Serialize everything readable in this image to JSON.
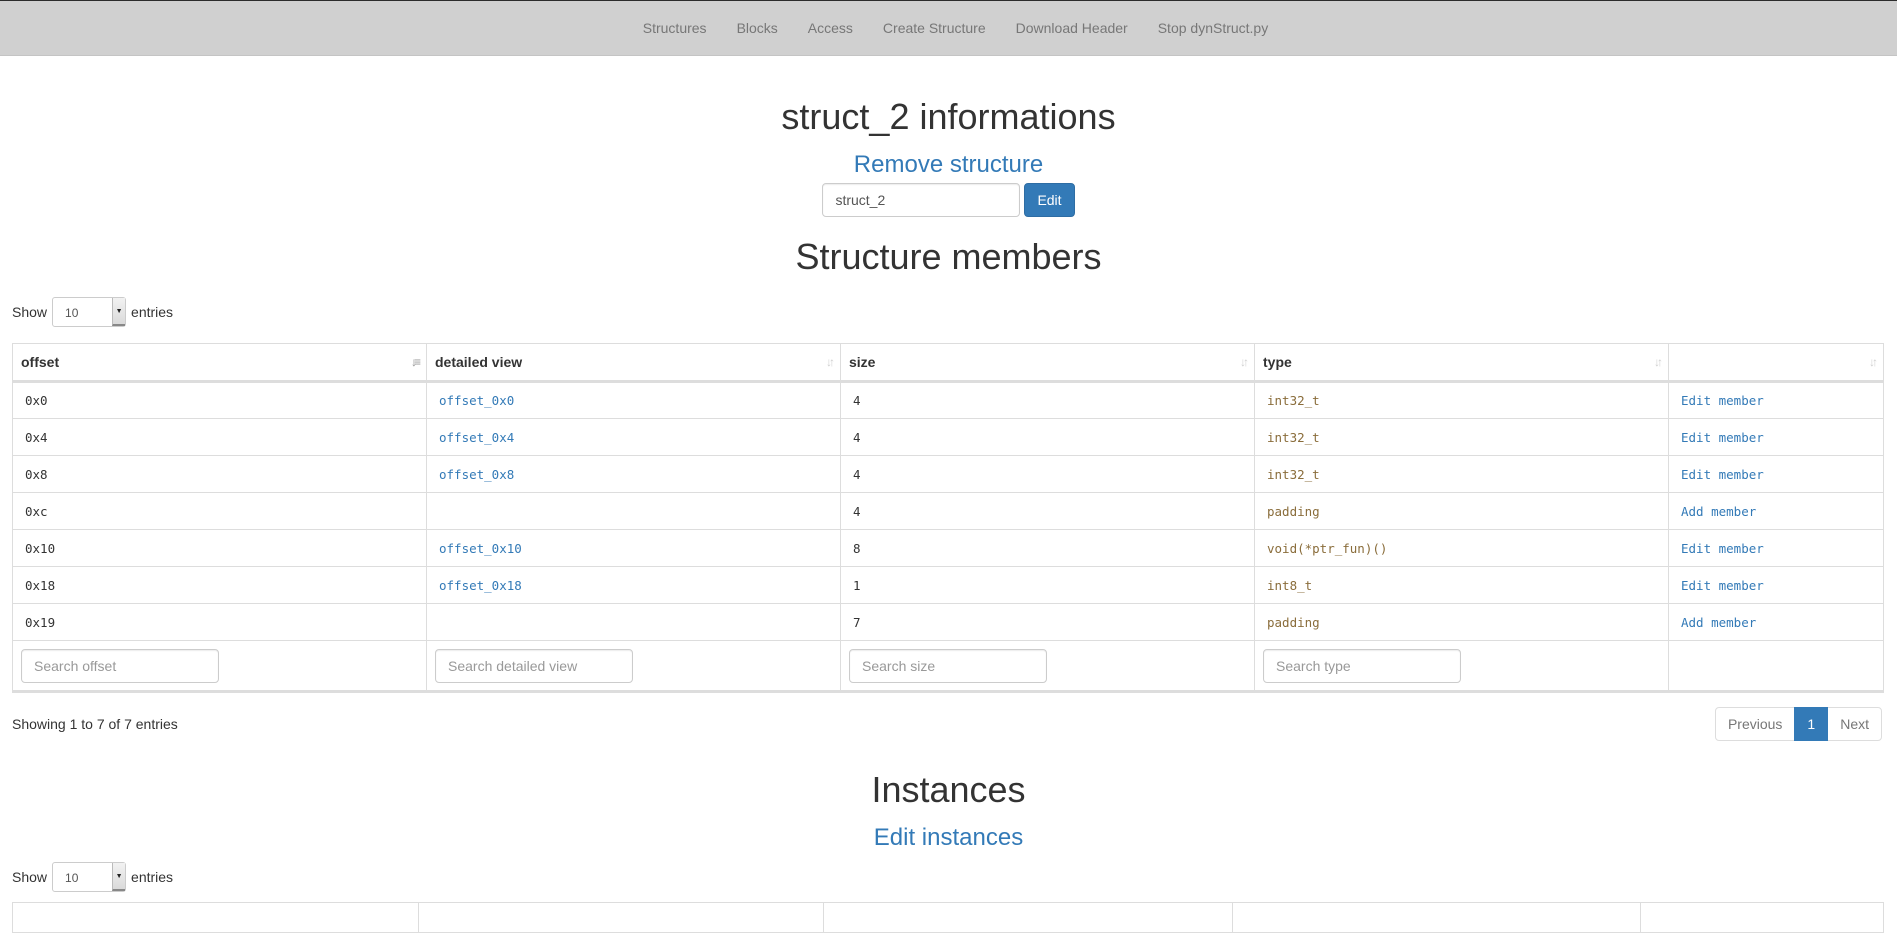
{
  "navbar": {
    "items": [
      "Structures",
      "Blocks",
      "Access",
      "Create Structure",
      "Download Header",
      "Stop dynStruct.py"
    ]
  },
  "structure": {
    "title": "struct_2 informations",
    "remove_label": "Remove structure",
    "name_value": "struct_2",
    "edit_label": "Edit"
  },
  "members": {
    "title": "Structure members",
    "length": {
      "show_label": "Show",
      "value": "10",
      "entries_label": "entries"
    },
    "columns": [
      "offset",
      "detailed view",
      "size",
      "type",
      ""
    ],
    "rows": [
      {
        "offset": "0x0",
        "detail": "offset_0x0",
        "size": "4",
        "type": "int32_t",
        "action": "Edit member"
      },
      {
        "offset": "0x4",
        "detail": "offset_0x4",
        "size": "4",
        "type": "int32_t",
        "action": "Edit member"
      },
      {
        "offset": "0x8",
        "detail": "offset_0x8",
        "size": "4",
        "type": "int32_t",
        "action": "Edit member"
      },
      {
        "offset": "0xc",
        "detail": "",
        "size": "4",
        "type": "padding",
        "action": "Add member"
      },
      {
        "offset": "0x10",
        "detail": "offset_0x10",
        "size": "8",
        "type": "void(*ptr_fun)()",
        "action": "Edit member"
      },
      {
        "offset": "0x18",
        "detail": "offset_0x18",
        "size": "1",
        "type": "int8_t",
        "action": "Edit member"
      },
      {
        "offset": "0x19",
        "detail": "",
        "size": "7",
        "type": "padding",
        "action": "Add member"
      }
    ],
    "search_placeholders": [
      "Search offset",
      "Search detailed view",
      "Search size",
      "Search type"
    ],
    "info": "Showing 1 to 7 of 7 entries",
    "pagination": {
      "previous": "Previous",
      "current": "1",
      "next": "Next"
    }
  },
  "instances": {
    "title": "Instances",
    "edit_label": "Edit instances",
    "length": {
      "show_label": "Show",
      "value": "10",
      "entries_label": "entries"
    }
  }
}
